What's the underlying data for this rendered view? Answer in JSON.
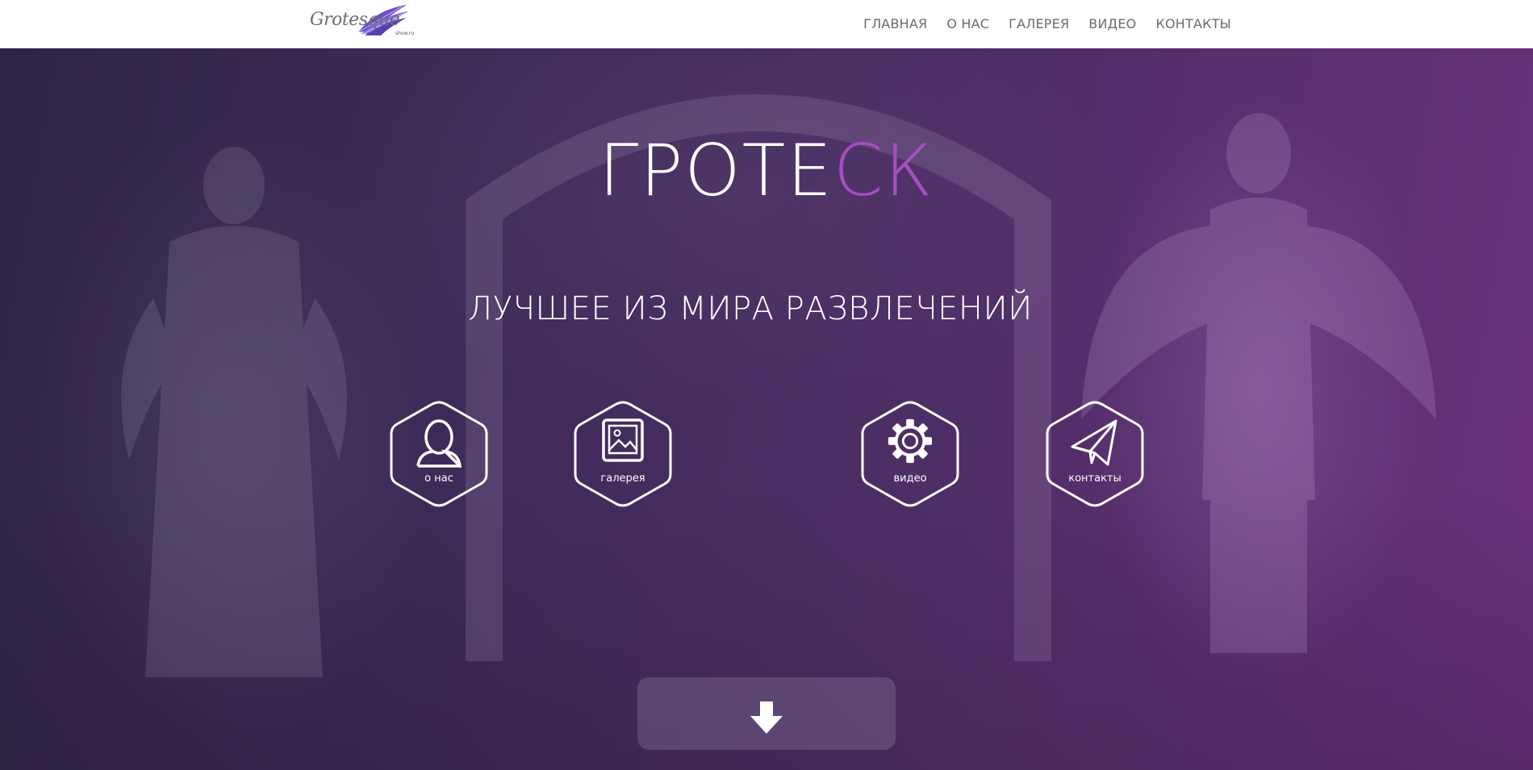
{
  "header": {
    "logo": {
      "text": "Grotesque",
      "sub": "show.ru"
    },
    "nav": [
      "ГЛАВНАЯ",
      "О НАС",
      "ГАЛЕРЕЯ",
      "ВИДЕО",
      "КОНТАКТЫ"
    ]
  },
  "hero": {
    "title_main": "ГРОТЕ",
    "title_accent": "СК",
    "subtitle": "ЛУЧШЕЕ ИЗ МИРА РАЗВЛЕЧЕНИЙ",
    "buttons": [
      {
        "label": "о нас",
        "icon": "user-icon"
      },
      {
        "label": "галерея",
        "icon": "image-icon"
      },
      {
        "label": "видео",
        "icon": "gear-icon"
      },
      {
        "label": "контакты",
        "icon": "paper-plane-icon"
      }
    ],
    "scroll_icon": "arrow-down-icon"
  },
  "colors": {
    "accent": "#a34fbf",
    "nav_text": "#6b6b6b",
    "hero_left": "#2f2445",
    "hero_right": "#6a3079"
  }
}
